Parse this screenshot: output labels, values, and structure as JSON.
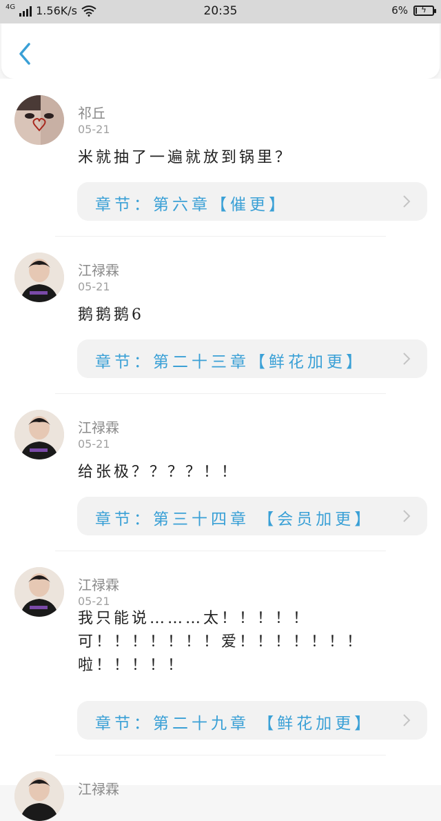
{
  "status_bar": {
    "network": "4G",
    "speed": "1.56K/s",
    "time": "20:35",
    "battery": "6%",
    "battery_level": 0.06
  },
  "navbar": {
    "back_icon": "chevron-left-icon"
  },
  "colors": {
    "accent": "#3aa0d6",
    "chip_bg": "#f2f2f2"
  },
  "comments": [
    {
      "username": "祁丘",
      "date": "05-21",
      "lines": [
        "米就抽了一遍就放到锅里？"
      ],
      "chapter": "章节：第六章【催更】"
    },
    {
      "username": "江禄霖",
      "date": "05-21",
      "lines": [
        "鹅鹅鹅6"
      ],
      "chapter": "章节：第二十三章【鲜花加更】"
    },
    {
      "username": "江禄霖",
      "date": "05-21",
      "lines": [
        "给张极？？？？！！"
      ],
      "chapter": "章节：第三十四章 【会员加更】"
    },
    {
      "username": "江禄霖",
      "date": "05-21",
      "lines": [
        "我只能说………太！！！！！",
        "可！！！！！！！爱！！！！！！！",
        "啦！！！！！"
      ],
      "chapter": "章节：第二十九章 【鲜花加更】"
    },
    {
      "username": "江禄霖"
    }
  ]
}
